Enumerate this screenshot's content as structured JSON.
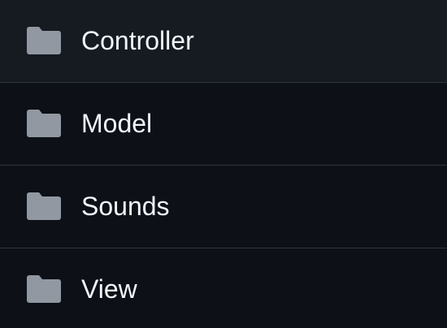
{
  "folders": [
    {
      "name": "Controller",
      "icon": "folder-icon"
    },
    {
      "name": "Model",
      "icon": "folder-icon"
    },
    {
      "name": "Sounds",
      "icon": "folder-icon"
    },
    {
      "name": "View",
      "icon": "folder-icon"
    }
  ],
  "colors": {
    "background": "#0d1117",
    "divider": "#30363d",
    "folder_icon": "#9198a1",
    "text": "#f0f6fc"
  }
}
